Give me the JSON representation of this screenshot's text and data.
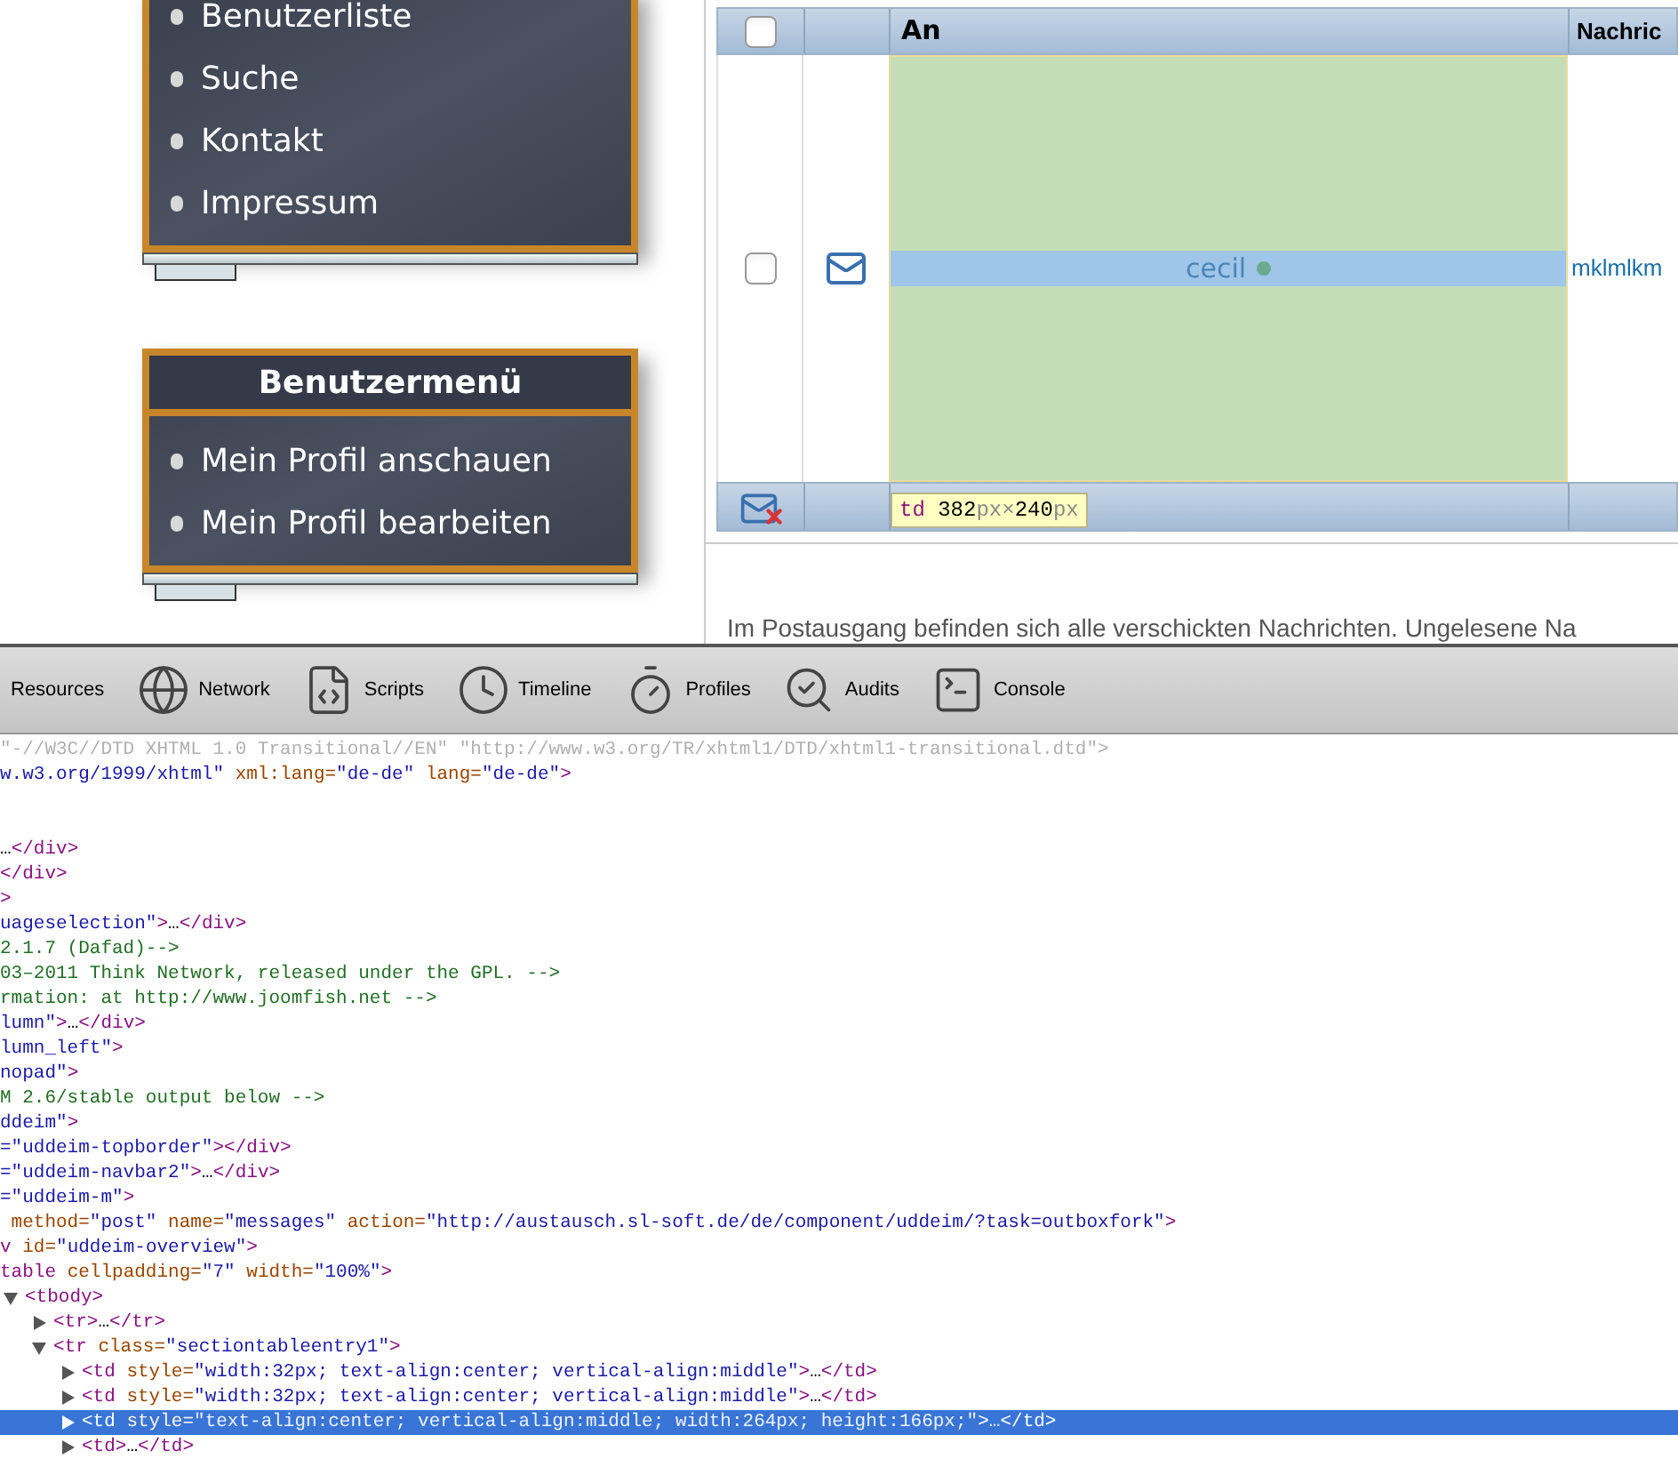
{
  "sidebar": {
    "menus": [
      {
        "items": [
          "Benutzerliste",
          "Suche",
          "Kontakt",
          "Impressum"
        ]
      },
      {
        "title": "Benutzermenü",
        "items": [
          "Mein Profil anschauen",
          "Mein Profil bearbeiten"
        ]
      }
    ]
  },
  "messages_table": {
    "columns": [
      "An",
      "Nachric"
    ],
    "header_checkbox": {
      "checked": false
    },
    "rows": [
      {
        "checked": false,
        "recipient": "cecil",
        "message": "mklmlkm"
      }
    ]
  },
  "inspector_tooltip": [
    {
      "text": "td",
      "kind": "tag"
    },
    {
      "text": " 382",
      "kind": "num"
    },
    {
      "text": "px×",
      "kind": "unit"
    },
    {
      "text": "240",
      "kind": "num"
    },
    {
      "text": "px",
      "kind": "unit"
    }
  ],
  "info_text": "Im Postausgang befinden sich alle verschickten Nachrichten. Ungelesene Na",
  "devtools": {
    "tabs": [
      {
        "label": "Resources",
        "selected": false
      },
      {
        "label": "Network",
        "selected": false
      },
      {
        "label": "Scripts",
        "selected": false
      },
      {
        "label": "Timeline",
        "selected": false
      },
      {
        "label": "Profiles",
        "selected": false
      },
      {
        "label": "Audits",
        "selected": false
      },
      {
        "label": "Console",
        "selected": false
      }
    ],
    "source_lines": [
      [
        {
          "text": "\"-//W3C//DTD XHTML 1.0 Transitional//EN\" \"http://www.w3.org/TR/xhtml1/DTD/xhtml1-transitional.dtd\">",
          "kind": "doctype"
        }
      ],
      [
        {
          "text": "w.w3.org/1999/xhtml\"",
          "kind": "value"
        },
        {
          "text": " xml:lang=",
          "kind": "attr"
        },
        {
          "text": "\"de-de\"",
          "kind": "value"
        },
        {
          "text": " lang=",
          "kind": "attr"
        },
        {
          "text": "\"de-de\"",
          "kind": "value"
        },
        {
          "text": ">",
          "kind": "tag"
        }
      ],
      [
        {
          "text": "…",
          "kind": "text"
        },
        {
          "text": "</div>",
          "kind": "tag"
        }
      ],
      [
        {
          "text": "</div>",
          "kind": "tag"
        }
      ],
      [
        {
          "text": ">",
          "kind": "tag"
        }
      ],
      [
        {
          "text": "uageselection\"",
          "kind": "value"
        },
        {
          "text": ">",
          "kind": "tag"
        },
        {
          "text": "…",
          "kind": "text"
        },
        {
          "text": "</div>",
          "kind": "tag"
        }
      ],
      [
        {
          "text": "2.1.7 (Dafad)-->",
          "kind": "comment"
        }
      ],
      [
        {
          "text": "03–2011 Think Network, released under the GPL. -->",
          "kind": "comment"
        }
      ],
      [
        {
          "text": "rmation: at http://www.joomfish.net -->",
          "kind": "comment"
        }
      ],
      [
        {
          "text": "lumn\"",
          "kind": "value"
        },
        {
          "text": ">",
          "kind": "tag"
        },
        {
          "text": "…",
          "kind": "text"
        },
        {
          "text": "</div>",
          "kind": "tag"
        }
      ],
      [
        {
          "text": "lumn_left\"",
          "kind": "value"
        },
        {
          "text": ">",
          "kind": "tag"
        }
      ],
      [
        {
          "text": "nopad\"",
          "kind": "value"
        },
        {
          "text": ">",
          "kind": "tag"
        }
      ],
      [
        {
          "text": "M 2.6/stable output below -->",
          "kind": "comment"
        }
      ],
      [
        {
          "text": "ddeim\"",
          "kind": "value"
        },
        {
          "text": ">",
          "kind": "tag"
        }
      ],
      [
        {
          "text": "=\"uddeim-topborder\"",
          "kind": "value"
        },
        {
          "text": "></div>",
          "kind": "tag"
        }
      ],
      [
        {
          "text": "=\"uddeim-navbar2\"",
          "kind": "value"
        },
        {
          "text": ">",
          "kind": "tag"
        },
        {
          "text": "…",
          "kind": "text"
        },
        {
          "text": "</div>",
          "kind": "tag"
        }
      ],
      [
        {
          "text": "=\"uddeim-m\"",
          "kind": "value"
        },
        {
          "text": ">",
          "kind": "tag"
        }
      ],
      [
        {
          "text": " method=",
          "kind": "attr"
        },
        {
          "text": "\"post\"",
          "kind": "value"
        },
        {
          "text": " name=",
          "kind": "attr"
        },
        {
          "text": "\"messages\"",
          "kind": "value"
        },
        {
          "text": " action=",
          "kind": "attr"
        },
        {
          "text": "\"http://austausch.sl-soft.de/de/component/uddeim/?task=outboxfork\"",
          "kind": "value"
        },
        {
          "text": ">",
          "kind": "tag"
        }
      ],
      [
        {
          "text": "v",
          "kind": "tag"
        },
        {
          "text": " id=",
          "kind": "attr"
        },
        {
          "text": "\"uddeim-overview\"",
          "kind": "value"
        },
        {
          "text": ">",
          "kind": "tag"
        }
      ],
      [
        {
          "text": "table",
          "kind": "tag"
        },
        {
          "text": " cellpadding=",
          "kind": "attr"
        },
        {
          "text": "\"7\"",
          "kind": "value"
        },
        {
          "text": " width=",
          "kind": "attr"
        },
        {
          "text": "\"100%\"",
          "kind": "value"
        },
        {
          "text": ">",
          "kind": "tag"
        }
      ]
    ],
    "dom_tree": [
      {
        "segments": [
          {
            "text": "<tbody>",
            "kind": "tag"
          }
        ],
        "expanded": true,
        "selected": false,
        "children": [
          {
            "segments": [
              {
                "text": "<tr>",
                "kind": "tag"
              },
              {
                "text": "…",
                "kind": "text"
              },
              {
                "text": "</tr>",
                "kind": "tag"
              }
            ],
            "expanded": false,
            "selected": false
          },
          {
            "segments": [
              {
                "text": "<tr",
                "kind": "tag"
              },
              {
                "text": " class=",
                "kind": "attr"
              },
              {
                "text": "\"sectiontableentry1\"",
                "kind": "value"
              },
              {
                "text": ">",
                "kind": "tag"
              }
            ],
            "expanded": true,
            "selected": false,
            "children": [
              {
                "segments": [
                  {
                    "text": "<td",
                    "kind": "tag"
                  },
                  {
                    "text": " style=",
                    "kind": "attr"
                  },
                  {
                    "text": "\"width:32px; text-align:center; vertical-align:middle\"",
                    "kind": "value"
                  },
                  {
                    "text": ">",
                    "kind": "tag"
                  },
                  {
                    "text": "…",
                    "kind": "text"
                  },
                  {
                    "text": "</td>",
                    "kind": "tag"
                  }
                ],
                "expanded": false,
                "selected": false
              },
              {
                "segments": [
                  {
                    "text": "<td",
                    "kind": "tag"
                  },
                  {
                    "text": " style=",
                    "kind": "attr"
                  },
                  {
                    "text": "\"width:32px; text-align:center; vertical-align:middle\"",
                    "kind": "value"
                  },
                  {
                    "text": ">",
                    "kind": "tag"
                  },
                  {
                    "text": "…",
                    "kind": "text"
                  },
                  {
                    "text": "</td>",
                    "kind": "tag"
                  }
                ],
                "expanded": false,
                "selected": false
              },
              {
                "segments": [
                  {
                    "text": "<td",
                    "kind": "tag"
                  },
                  {
                    "text": " style=",
                    "kind": "attr"
                  },
                  {
                    "text": "\"text-align:center; vertical-align:middle; width:264px; height:166px;\"",
                    "kind": "value"
                  },
                  {
                    "text": ">",
                    "kind": "tag"
                  },
                  {
                    "text": "…",
                    "kind": "text"
                  },
                  {
                    "text": "</td>",
                    "kind": "tag"
                  }
                ],
                "expanded": false,
                "selected": true
              },
              {
                "segments": [
                  {
                    "text": "<td>",
                    "kind": "tag"
                  },
                  {
                    "text": "…",
                    "kind": "text"
                  },
                  {
                    "text": "</td>",
                    "kind": "tag"
                  }
                ],
                "expanded": false,
                "selected": false
              }
            ]
          }
        ]
      }
    ]
  }
}
